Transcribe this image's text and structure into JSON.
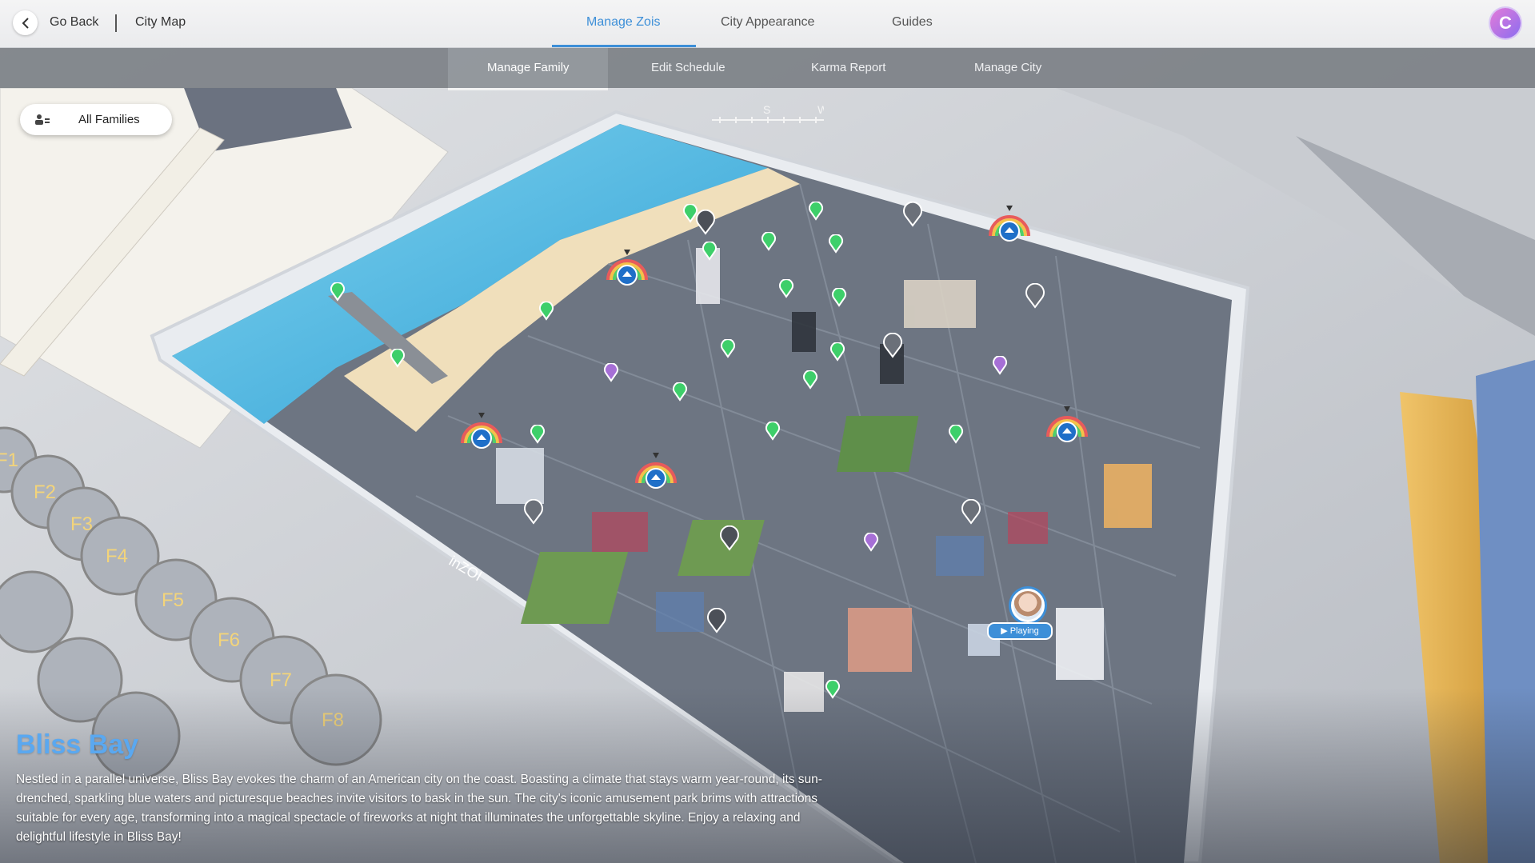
{
  "header": {
    "back_label": "Go Back",
    "location": "City Map",
    "tabs": [
      "Manage Zois",
      "City Appearance",
      "Guides"
    ],
    "active_tab": "Manage Zois",
    "profile_initial": "C"
  },
  "subnav": {
    "tabs": [
      "Manage Family",
      "Edit Schedule",
      "Karma Report",
      "Manage City"
    ],
    "active_tab": "Manage Family"
  },
  "filter": {
    "label": "All Families"
  },
  "compass": {
    "letters": [
      "S",
      "W"
    ]
  },
  "tablet_brand": "inZOI",
  "status": {
    "playing_label": "Playing"
  },
  "city": {
    "name": "Bliss Bay",
    "description": "Nestled in a parallel universe, Bliss Bay evokes the charm of an American city on the coast. Boasting a climate that stays warm year-round, its sun-drenched, sparkling blue waters and picturesque beaches invite visitors to bask in the sun. The city's iconic amusement park brims with attractions suitable for every age, transforming into a magical spectacle of fireworks at night that illuminates the unforgettable skyline. Enjoy a relaxing and delightful lifestyle in Bliss Bay!"
  },
  "keyboard": {
    "keys": [
      "F1",
      "F2",
      "F3",
      "F4",
      "F5",
      "F6",
      "F7",
      "F8"
    ]
  },
  "colors": {
    "accent": "#3d8fd8",
    "city_name": "#5aa8f0",
    "marker_green": "#3ecf6a",
    "marker_purple": "#a66fd6"
  }
}
